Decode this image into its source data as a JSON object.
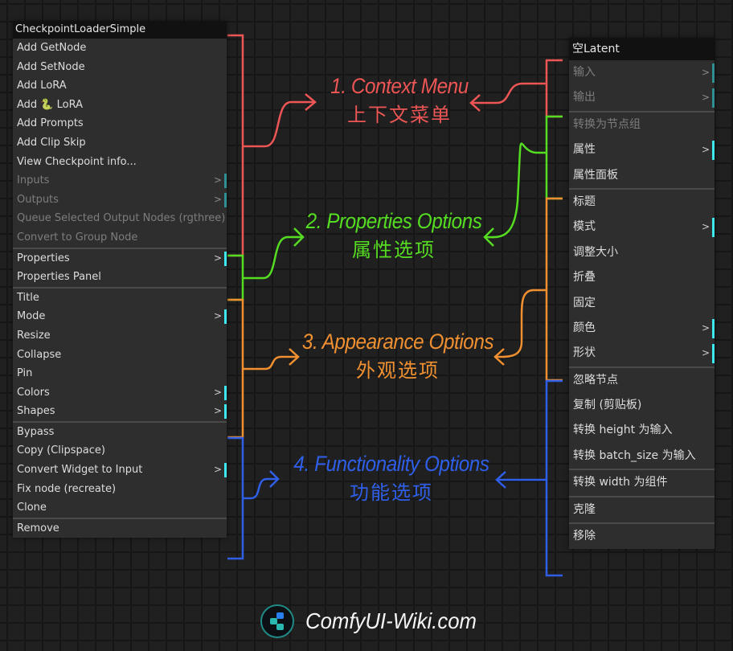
{
  "left_menu": {
    "title": "CheckpointLoaderSimple",
    "groups": [
      {
        "items": [
          {
            "label": "Add GetNode",
            "disabled": false,
            "submenu": false
          },
          {
            "label": "Add SetNode",
            "disabled": false,
            "submenu": false
          },
          {
            "label": "Add LoRA",
            "disabled": false,
            "submenu": false
          },
          {
            "label": "Add 🐍 LoRA",
            "disabled": false,
            "submenu": false
          },
          {
            "label": "Add Prompts",
            "disabled": false,
            "submenu": false
          },
          {
            "label": "Add Clip Skip",
            "disabled": false,
            "submenu": false
          },
          {
            "label": "View Checkpoint info...",
            "disabled": false,
            "submenu": false
          },
          {
            "label": "Inputs",
            "disabled": true,
            "submenu": true
          },
          {
            "label": "Outputs",
            "disabled": true,
            "submenu": true
          },
          {
            "label": "Queue Selected Output Nodes (rgthree)",
            "disabled": true,
            "submenu": false
          },
          {
            "label": "Convert to Group Node",
            "disabled": true,
            "submenu": false
          }
        ]
      },
      {
        "items": [
          {
            "label": "Properties",
            "disabled": false,
            "submenu": true
          },
          {
            "label": "Properties Panel",
            "disabled": false,
            "submenu": false
          }
        ]
      },
      {
        "items": [
          {
            "label": "Title",
            "disabled": false,
            "submenu": false
          },
          {
            "label": "Mode",
            "disabled": false,
            "submenu": true
          },
          {
            "label": "Resize",
            "disabled": false,
            "submenu": false
          },
          {
            "label": "Collapse",
            "disabled": false,
            "submenu": false
          },
          {
            "label": "Pin",
            "disabled": false,
            "submenu": false
          },
          {
            "label": "Colors",
            "disabled": false,
            "submenu": true
          },
          {
            "label": "Shapes",
            "disabled": false,
            "submenu": true
          }
        ]
      },
      {
        "items": [
          {
            "label": "Bypass",
            "disabled": false,
            "submenu": false
          },
          {
            "label": "Copy (Clipspace)",
            "disabled": false,
            "submenu": false
          },
          {
            "label": "Convert Widget to Input",
            "disabled": false,
            "submenu": true
          },
          {
            "label": "Fix node (recreate)",
            "disabled": false,
            "submenu": false
          },
          {
            "label": "Clone",
            "disabled": false,
            "submenu": false
          }
        ]
      },
      {
        "items": [
          {
            "label": "Remove",
            "disabled": false,
            "submenu": false
          }
        ]
      }
    ]
  },
  "right_menu": {
    "title": "空Latent",
    "groups": [
      {
        "items": [
          {
            "label": "输入",
            "disabled": true,
            "submenu": true
          },
          {
            "label": "输出",
            "disabled": true,
            "submenu": true
          }
        ]
      },
      {
        "items": [
          {
            "label": "转换为节点组",
            "disabled": true,
            "submenu": false
          },
          {
            "label": "属性",
            "disabled": false,
            "submenu": true
          },
          {
            "label": "属性面板",
            "disabled": false,
            "submenu": false
          }
        ]
      },
      {
        "items": [
          {
            "label": "标题",
            "disabled": false,
            "submenu": false
          },
          {
            "label": "模式",
            "disabled": false,
            "submenu": true
          },
          {
            "label": "调整大小",
            "disabled": false,
            "submenu": false
          },
          {
            "label": "折叠",
            "disabled": false,
            "submenu": false
          },
          {
            "label": "固定",
            "disabled": false,
            "submenu": false
          },
          {
            "label": "颜色",
            "disabled": false,
            "submenu": true
          },
          {
            "label": "形状",
            "disabled": false,
            "submenu": true
          }
        ]
      },
      {
        "items": [
          {
            "label": "忽略节点",
            "disabled": false,
            "submenu": false
          },
          {
            "label": "复制 (剪贴板)",
            "disabled": false,
            "submenu": false
          },
          {
            "label": "转换 height 为输入",
            "disabled": false,
            "submenu": false
          },
          {
            "label": "转换 batch_size 为输入",
            "disabled": false,
            "submenu": false
          }
        ]
      },
      {
        "items": [
          {
            "label": "转换 width 为组件",
            "disabled": false,
            "submenu": false
          }
        ]
      },
      {
        "items": [
          {
            "label": "克隆",
            "disabled": false,
            "submenu": false
          }
        ]
      },
      {
        "items": [
          {
            "label": "移除",
            "disabled": false,
            "submenu": false
          }
        ]
      }
    ]
  },
  "submenu_arrow": ">",
  "annotations": [
    {
      "en": "1.  Context Menu",
      "zh": "上下文菜单",
      "color": "#ee5555"
    },
    {
      "en": "2. Properties Options",
      "zh": "属性选项",
      "color": "#55dd22"
    },
    {
      "en": "3. Appearance Options",
      "zh": "外观选项",
      "color": "#f09030"
    },
    {
      "en": "4.  Functionality Options",
      "zh": "功能选项",
      "color": "#2f5fe8"
    }
  ],
  "footer": {
    "site": "ComfyUI-Wiki.com",
    "logo_icon": "comfyui-wiki-logo-icon"
  }
}
